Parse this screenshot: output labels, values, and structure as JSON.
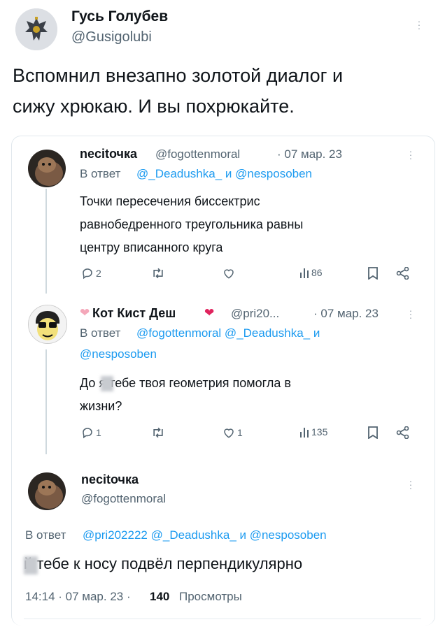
{
  "main_tweet": {
    "name": "Гусь Голубев",
    "handle": "@Gusigolubi",
    "text_line1": "Вспомнил внезапно золотой диалог и",
    "text_line2": "сижу хрюкаю. И вы похрюкайте."
  },
  "quoted": {
    "tweet1": {
      "name": "necitочка",
      "handle": "@fogottenmoral",
      "date": "· 07 мар. 23",
      "reply_prefix": "В ответ",
      "reply_users": "@_Deadushka_ и @nesposoben",
      "text_line1": "Точки пересечения биссектрис",
      "text_line2": "равнобедренного треугольника равны",
      "text_line3": "центру вписанного круга",
      "replies": "2",
      "retweets": "",
      "likes": "",
      "views": "86"
    },
    "tweet2": {
      "name": "Кот Кист Деш",
      "handle": "@pri20...",
      "date": "· 07 мар. 23",
      "reply_prefix": "В ответ",
      "reply_users_line1": "@fogottenmoral @_Deadushka_ и",
      "reply_users_line2": "@nesposoben",
      "text_line1": "До  я тебе твоя геометрия помогла в",
      "text_line2": "жизни?",
      "replies": "1",
      "retweets": "",
      "likes": "1",
      "views": "135"
    },
    "tweet3": {
      "name": "necitочка",
      "handle": "@fogottenmoral",
      "reply_prefix": "В ответ",
      "reply_users": "@pri202222 @_Deadushka_ и @nesposoben",
      "text": "  й тебе к носу подвёл перпендикулярно",
      "time": "14:14 · 07 мар. 23 ·",
      "views_count": "140",
      "views_label": "Просмотры"
    }
  },
  "colors": {
    "link": "#1d9bf0",
    "muted": "#536471",
    "border": "#e1e8ed",
    "heart": "#f4a7b9"
  }
}
